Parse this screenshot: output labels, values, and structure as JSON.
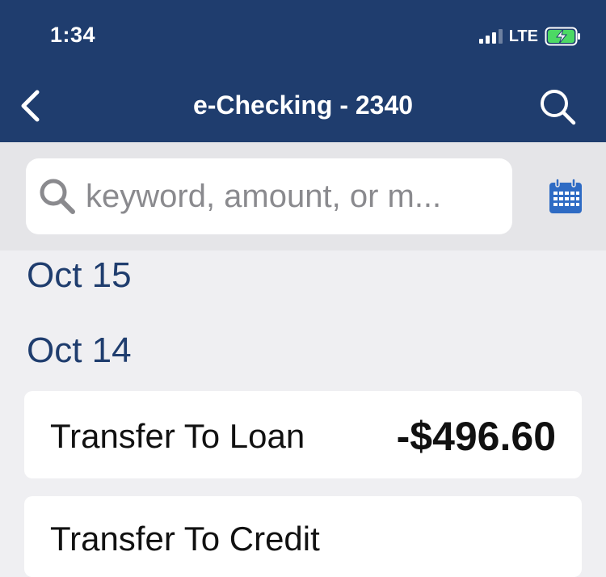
{
  "status_bar": {
    "time": "1:34",
    "network": "LTE"
  },
  "header": {
    "title": "e-Checking - 2340"
  },
  "search": {
    "placeholder": "keyword, amount, or m..."
  },
  "groups": [
    {
      "date": "Oct 15"
    },
    {
      "date": "Oct 14"
    }
  ],
  "transactions": [
    {
      "description": "Transfer To Loan",
      "amount": "-$496.60"
    },
    {
      "description": "Transfer To Credit",
      "amount": ""
    }
  ],
  "colors": {
    "header_bg": "#1f3d6e",
    "accent": "#1f3d6e",
    "calendar_icon": "#2e6bc4",
    "battery_charge": "#4cd964"
  }
}
